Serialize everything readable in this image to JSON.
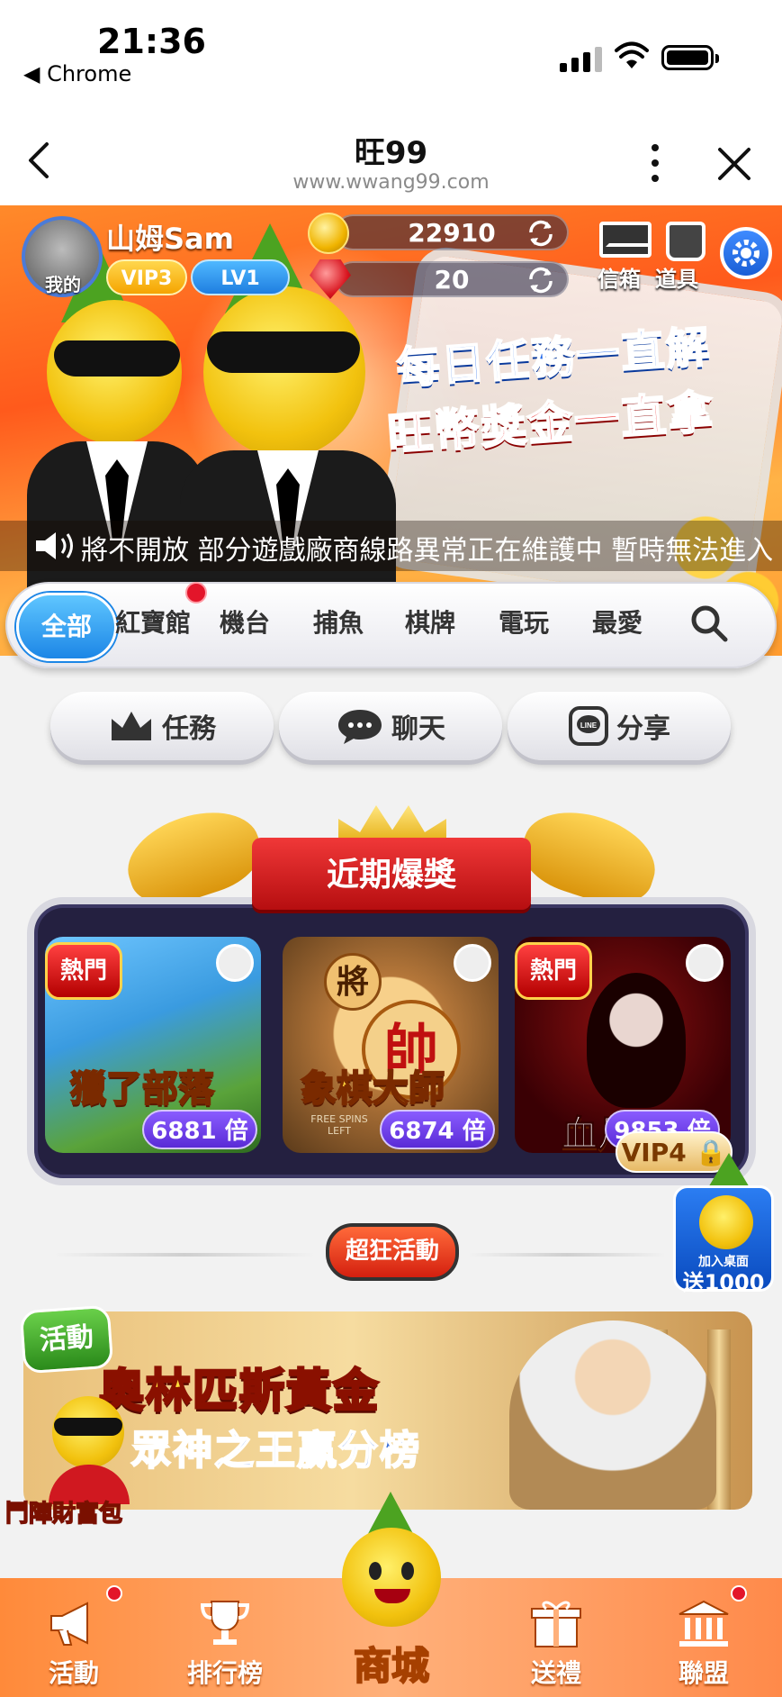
{
  "status_bar": {
    "time": "21:36",
    "back_app": "◀ Chrome"
  },
  "nav": {
    "title": "旺99",
    "url": "www.wwang99.com"
  },
  "profile": {
    "avatar_label": "我的",
    "username": "山姆Sam",
    "vip": "VIP3",
    "level": "LV1",
    "gold": "22910",
    "gems": "20",
    "mailbox_label": "信箱",
    "items_label": "道具"
  },
  "banner": {
    "line1": "每日任務一直解",
    "line2": "旺幣獎金一直拿"
  },
  "marquee": {
    "text": "將不開放 部分遊戲廠商線路異常正在維護中 暫時無法進入 請"
  },
  "tabs": {
    "all": "全部",
    "red_treasure": "紅寶館",
    "slots": "機台",
    "fishing": "捕魚",
    "cards": "棋牌",
    "arcade": "電玩",
    "favorites": "最愛"
  },
  "actions": {
    "tasks": "任務",
    "chat": "聊天",
    "share": "分享",
    "line_badge": "LINE"
  },
  "jackpot": {
    "title": "近期爆獎",
    "games": [
      {
        "badge": "熱門",
        "name": "獵了部落",
        "multiplier": "6881 倍"
      },
      {
        "badge": "",
        "name": "象棋大師",
        "multiplier": "6874 倍",
        "overlay": "FREE SPINS LEFT",
        "piece_top": "將",
        "piece_main": "帥"
      },
      {
        "badge": "熱門",
        "name": "血月",
        "multiplier": "9853 倍"
      }
    ],
    "vip_lock": "VIP4"
  },
  "float_promo": {
    "line1": "加入桌面",
    "line2": "送1000"
  },
  "crazy_events": "超狂活動",
  "event_banner": {
    "badge": "活動",
    "title": "奧林匹斯黃金",
    "subtitle": "眾神之王贏分榜",
    "side_label": "鬥陣財富包"
  },
  "bottom_nav": {
    "events": "活動",
    "ranking": "排行榜",
    "shop": "商城",
    "gifts": "送禮",
    "alliance": "聯盟"
  },
  "colors": {
    "accent_blue": "#1c86e6",
    "banner_orange": "#ff5a1c",
    "ribbon_red": "#d4200f",
    "gold": "#ffd23a"
  }
}
